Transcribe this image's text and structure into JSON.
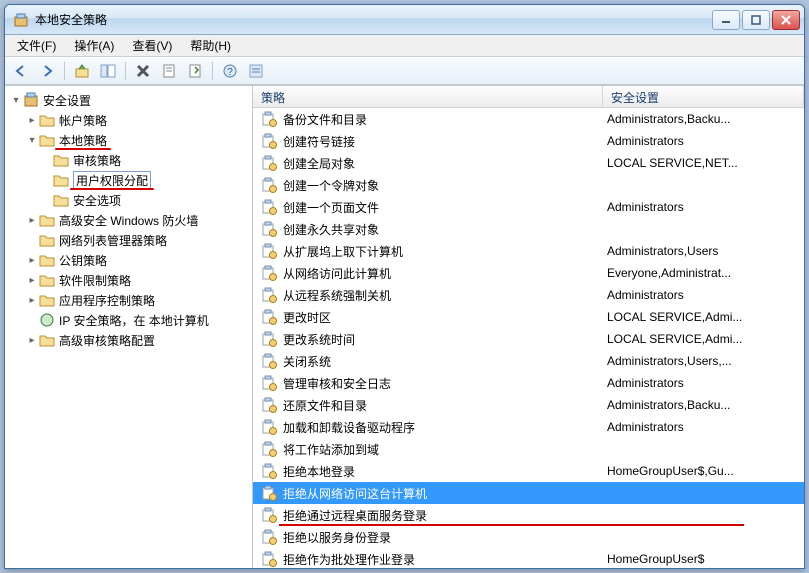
{
  "window": {
    "title": "本地安全策略"
  },
  "menu": {
    "file": "文件(F)",
    "action": "操作(A)",
    "view": "查看(V)",
    "help": "帮助(H)"
  },
  "tree": {
    "root": "安全设置",
    "accountPolicy": "帐户策略",
    "localPolicy": "本地策略",
    "auditPolicy": "审核策略",
    "userRights": "用户权限分配",
    "securityOptions": "安全选项",
    "firewall": "高级安全 Windows 防火墙",
    "nlmp": "网络列表管理器策略",
    "pubkey": "公钥策略",
    "swRestrict": "软件限制策略",
    "appControl": "应用程序控制策略",
    "ipsec": "IP 安全策略，在 本地计算机",
    "advAudit": "高级审核策略配置"
  },
  "columns": {
    "policy": "策略",
    "setting": "安全设置"
  },
  "policies": [
    {
      "name": "备份文件和目录",
      "setting": "Administrators,Backu..."
    },
    {
      "name": "创建符号链接",
      "setting": "Administrators"
    },
    {
      "name": "创建全局对象",
      "setting": "LOCAL SERVICE,NET..."
    },
    {
      "name": "创建一个令牌对象",
      "setting": ""
    },
    {
      "name": "创建一个页面文件",
      "setting": "Administrators"
    },
    {
      "name": "创建永久共享对象",
      "setting": ""
    },
    {
      "name": "从扩展坞上取下计算机",
      "setting": "Administrators,Users"
    },
    {
      "name": "从网络访问此计算机",
      "setting": "Everyone,Administrat..."
    },
    {
      "name": "从远程系统强制关机",
      "setting": "Administrators"
    },
    {
      "name": "更改时区",
      "setting": "LOCAL SERVICE,Admi..."
    },
    {
      "name": "更改系统时间",
      "setting": "LOCAL SERVICE,Admi..."
    },
    {
      "name": "关闭系统",
      "setting": "Administrators,Users,..."
    },
    {
      "name": "管理审核和安全日志",
      "setting": "Administrators"
    },
    {
      "name": "还原文件和目录",
      "setting": "Administrators,Backu..."
    },
    {
      "name": "加载和卸载设备驱动程序",
      "setting": "Administrators"
    },
    {
      "name": "将工作站添加到域",
      "setting": ""
    },
    {
      "name": "拒绝本地登录",
      "setting": "HomeGroupUser$,Gu..."
    },
    {
      "name": "拒绝从网络访问这台计算机",
      "setting": "",
      "selected": true
    },
    {
      "name": "拒绝通过远程桌面服务登录",
      "setting": "",
      "redline": true
    },
    {
      "name": "拒绝以服务身份登录",
      "setting": ""
    },
    {
      "name": "拒绝作为批处理作业登录",
      "setting": "HomeGroupUser$"
    }
  ]
}
